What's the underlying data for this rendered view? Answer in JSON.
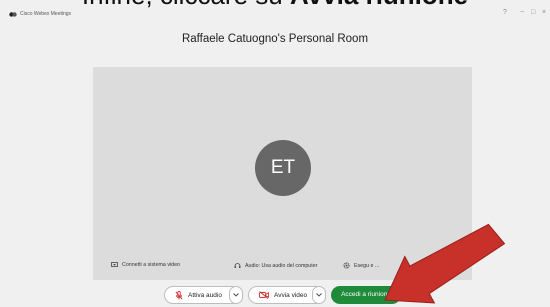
{
  "caption": {
    "before": "Infine, cliccare su ",
    "bold": "Avvia riunione"
  },
  "titlebar": {
    "app_name": "Cisco Webex Meetings",
    "help": "?",
    "minimize": "−",
    "maximize": "□",
    "close": "×"
  },
  "room": {
    "title": "Raffaele Catuogno's Personal Room"
  },
  "preview": {
    "initials": "ET"
  },
  "options": {
    "connect": "Connetti a sistema video",
    "audio": "Audio: Usa audio del computer",
    "test": "Esegu                    e ..."
  },
  "controls": {
    "audio_label": "Attiva audio",
    "video_label": "Avvia video",
    "join_label": "Accedi a riunione"
  },
  "colors": {
    "join": "#1e8a3a",
    "mute_red": "#d32f2f",
    "arrow": "#c8302a"
  }
}
